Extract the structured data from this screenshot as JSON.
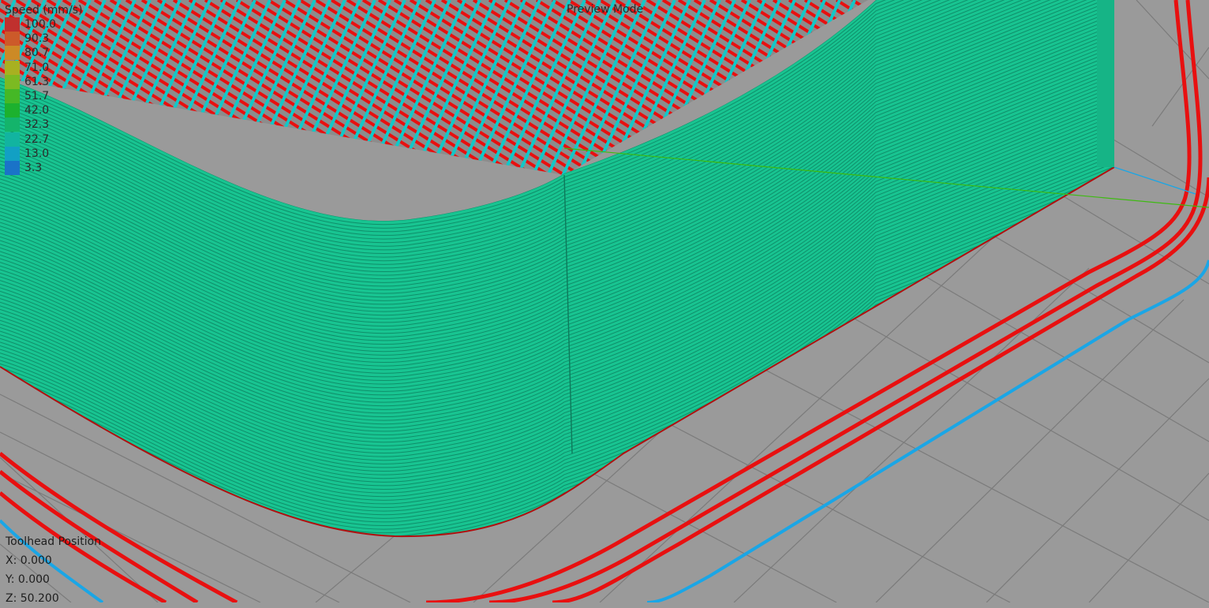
{
  "viewport": {
    "mode_label": "Preview Mode",
    "background": "#9a9a9a",
    "grid_color": "#7a7a7a",
    "wall_color": "#18c491",
    "infill_color": "#11c8c8",
    "brim_color": "#e81010",
    "travel_color": "#1aa6e6",
    "move_line_color": "#3dbb10"
  },
  "legend": {
    "title": "Speed (mm/s)",
    "entries": [
      {
        "value": "100.0",
        "color": "#c0302e"
      },
      {
        "value": "90.3",
        "color": "#cc5a2a"
      },
      {
        "value": "80.7",
        "color": "#cc8a26"
      },
      {
        "value": "71.0",
        "color": "#a8b021"
      },
      {
        "value": "61.3",
        "color": "#7cba22"
      },
      {
        "value": "51.7",
        "color": "#45b826"
      },
      {
        "value": "42.0",
        "color": "#1cb12e"
      },
      {
        "value": "32.3",
        "color": "#14b46b"
      },
      {
        "value": "22.7",
        "color": "#12b4a0"
      },
      {
        "value": "13.0",
        "color": "#12a0c4"
      },
      {
        "value": "3.3",
        "color": "#1a73c8"
      }
    ]
  },
  "toolhead": {
    "title": "Toolhead Position",
    "x_label": "X: 0.000",
    "y_label": "Y: 0.000",
    "z_label": "Z: 50.200"
  }
}
